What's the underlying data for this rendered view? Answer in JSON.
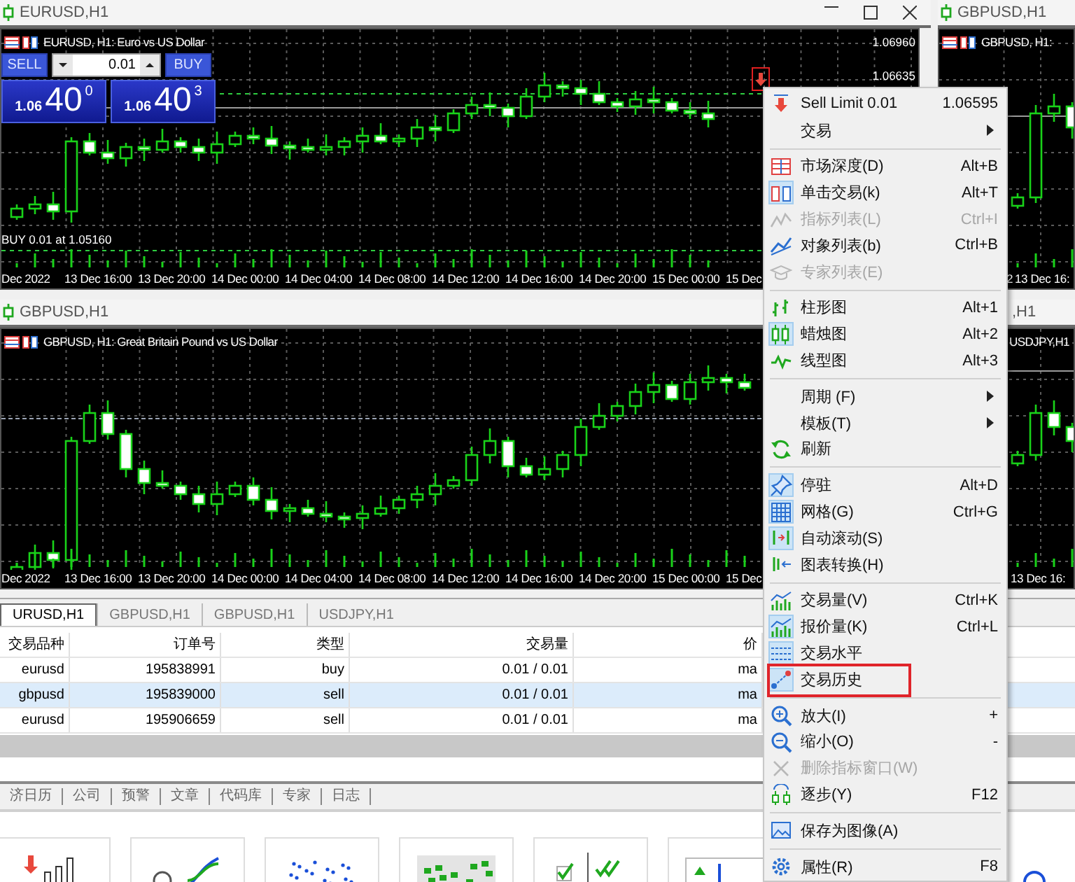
{
  "charts": [
    {
      "title": "EURUSD,H1",
      "window_controls": true,
      "header": "EURUSD, H1: Euro vs US Dollar",
      "header_icons": true,
      "marked": true,
      "price_labels": [
        "1.06960",
        "1.06635"
      ],
      "trade_panel": {
        "sell_label": "SELL",
        "buy_label": "BUY",
        "lot": "0.01",
        "sell_price": {
          "prefix": "1.06",
          "big": "40",
          "pip": "0"
        },
        "buy_price": {
          "prefix": "1.06",
          "big": "40",
          "pip": "3"
        }
      },
      "order_label": "BUY 0.01 at 1.05160",
      "time_labels": [
        "Dec 2022",
        "13 Dec 16:00",
        "13 Dec 20:00",
        "14 Dec 00:00",
        "14 Dec 04:00",
        "14 Dec 08:00",
        "14 Dec 12:00",
        "14 Dec 16:00",
        "14 Dec 20:00",
        "15 Dec 00:00",
        "15 Dec"
      ]
    },
    {
      "title": "GBPUSD,H1",
      "window_controls": false,
      "header": "GBPUSD, H1:",
      "header_icons": true,
      "time_labels": [
        "2",
        "13 Dec 16:"
      ]
    },
    {
      "title": "GBPUSD,H1",
      "window_controls": false,
      "header": "GBPUSD, H1: Great Britain Pound vs US Dollar",
      "header_icons": true,
      "time_labels": [
        "Dec 2022",
        "13 Dec 16:00",
        "13 Dec 20:00",
        "14 Dec 00:00",
        "14 Dec 04:00",
        "14 Dec 08:00",
        "14 Dec 12:00",
        "14 Dec 16:00",
        "14 Dec 20:00",
        "15 Dec 00:00",
        "15 Dec"
      ]
    },
    {
      "title": ",H1",
      "window_controls": false,
      "header": "USDJPY,H1",
      "header_icons": false,
      "time_labels": [
        "13 Dec 16:"
      ]
    }
  ],
  "chart_tabs": [
    {
      "label": "URUSD,H1",
      "selected": true
    },
    {
      "label": "GBPUSD,H1",
      "selected": false
    },
    {
      "label": "GBPUSD,H1",
      "selected": false
    },
    {
      "label": "USDJPY,H1",
      "selected": false
    }
  ],
  "table": {
    "columns": [
      "交易品种",
      "订单号",
      "类型",
      "交易量",
      "价"
    ],
    "rows": [
      {
        "cells": [
          "eurusd",
          "195838991",
          "buy",
          "0.01 / 0.01",
          "ma"
        ],
        "selected": false
      },
      {
        "cells": [
          "gbpusd",
          "195839000",
          "sell",
          "0.01 / 0.01",
          "ma"
        ],
        "selected": true
      },
      {
        "cells": [
          "eurusd",
          "195906659",
          "sell",
          "0.01 / 0.01",
          "ma"
        ],
        "selected": false
      }
    ]
  },
  "bottom_tabs": [
    {
      "label": "济日历",
      "selected": false
    },
    {
      "label": "公司",
      "selected": false
    },
    {
      "label": "预警",
      "selected": false
    },
    {
      "label": "文章",
      "selected": false
    },
    {
      "label": "代码库",
      "selected": false
    },
    {
      "label": "专家",
      "selected": false
    },
    {
      "label": "日志",
      "selected": false
    }
  ],
  "menu": {
    "items": [
      {
        "kind": "item",
        "label": "Sell Limit 0.01",
        "shortcut": "1.06595",
        "submenu": false,
        "checked": false,
        "disabled": false,
        "highlighted": false
      },
      {
        "kind": "item",
        "label": "交易",
        "submenu": true,
        "checked": false,
        "disabled": false,
        "highlighted": false
      },
      {
        "kind": "separator"
      },
      {
        "kind": "item",
        "label": "市场深度(D)",
        "shortcut": "Alt+B",
        "submenu": false,
        "checked": false,
        "disabled": false,
        "highlighted": false
      },
      {
        "kind": "item",
        "label": "单击交易(k)",
        "shortcut": "Alt+T",
        "submenu": false,
        "checked": true,
        "disabled": false,
        "highlighted": false
      },
      {
        "kind": "item",
        "label": "指标列表(L)",
        "shortcut": "Ctrl+I",
        "submenu": false,
        "checked": false,
        "disabled": true,
        "highlighted": false
      },
      {
        "kind": "item",
        "label": "对象列表(b)",
        "shortcut": "Ctrl+B",
        "submenu": false,
        "checked": false,
        "disabled": false,
        "highlighted": false
      },
      {
        "kind": "item",
        "label": "专家列表(E)",
        "submenu": false,
        "checked": false,
        "disabled": true,
        "highlighted": false
      },
      {
        "kind": "separator"
      },
      {
        "kind": "item",
        "label": "柱形图",
        "shortcut": "Alt+1",
        "submenu": false,
        "checked": false,
        "disabled": false,
        "highlighted": false
      },
      {
        "kind": "item",
        "label": "蜡烛图",
        "shortcut": "Alt+2",
        "submenu": false,
        "checked": true,
        "disabled": false,
        "highlighted": false
      },
      {
        "kind": "item",
        "label": "线型图",
        "shortcut": "Alt+3",
        "submenu": false,
        "checked": false,
        "disabled": false,
        "highlighted": false
      },
      {
        "kind": "separator"
      },
      {
        "kind": "item",
        "label": "周期 (F)",
        "submenu": true,
        "checked": false,
        "disabled": false,
        "highlighted": false
      },
      {
        "kind": "item",
        "label": "模板(T)",
        "submenu": true,
        "checked": false,
        "disabled": false,
        "highlighted": false
      },
      {
        "kind": "item",
        "label": "刷新",
        "submenu": false,
        "checked": false,
        "disabled": false,
        "highlighted": false
      },
      {
        "kind": "separator"
      },
      {
        "kind": "item",
        "label": "停驻",
        "shortcut": "Alt+D",
        "submenu": false,
        "checked": true,
        "disabled": false,
        "highlighted": false
      },
      {
        "kind": "item",
        "label": "网格(G)",
        "shortcut": "Ctrl+G",
        "submenu": false,
        "checked": true,
        "disabled": false,
        "highlighted": false
      },
      {
        "kind": "item",
        "label": "自动滚动(S)",
        "submenu": false,
        "checked": true,
        "disabled": false,
        "highlighted": false
      },
      {
        "kind": "item",
        "label": "图表转换(H)",
        "submenu": false,
        "checked": false,
        "disabled": false,
        "highlighted": false
      },
      {
        "kind": "separator"
      },
      {
        "kind": "item",
        "label": "交易量(V)",
        "shortcut": "Ctrl+K",
        "submenu": false,
        "checked": false,
        "disabled": false,
        "highlighted": false
      },
      {
        "kind": "item",
        "label": "报价量(K)",
        "shortcut": "Ctrl+L",
        "submenu": false,
        "checked": true,
        "disabled": false,
        "highlighted": false
      },
      {
        "kind": "item",
        "label": "交易水平",
        "submenu": false,
        "checked": true,
        "disabled": false,
        "highlighted": false
      },
      {
        "kind": "item",
        "label": "交易历史",
        "submenu": false,
        "checked": true,
        "disabled": false,
        "highlighted": true
      },
      {
        "kind": "separator"
      },
      {
        "kind": "item",
        "label": "放大(I)",
        "shortcut": "+",
        "submenu": false,
        "checked": false,
        "disabled": false,
        "highlighted": false
      },
      {
        "kind": "item",
        "label": "缩小(O)",
        "shortcut": "-",
        "submenu": false,
        "checked": false,
        "disabled": false,
        "highlighted": false
      },
      {
        "kind": "item",
        "label": "删除指标窗口(W)",
        "submenu": false,
        "checked": false,
        "disabled": true,
        "highlighted": false
      },
      {
        "kind": "item",
        "label": "逐步(Y)",
        "shortcut": "F12",
        "submenu": false,
        "checked": false,
        "disabled": false,
        "highlighted": false
      },
      {
        "kind": "separator"
      },
      {
        "kind": "item",
        "label": "保存为图像(A)",
        "submenu": false,
        "checked": false,
        "disabled": false,
        "highlighted": false
      },
      {
        "kind": "separator"
      },
      {
        "kind": "item",
        "label": "属性(R)",
        "shortcut": "F8",
        "submenu": false,
        "checked": false,
        "disabled": false,
        "highlighted": false
      }
    ]
  }
}
